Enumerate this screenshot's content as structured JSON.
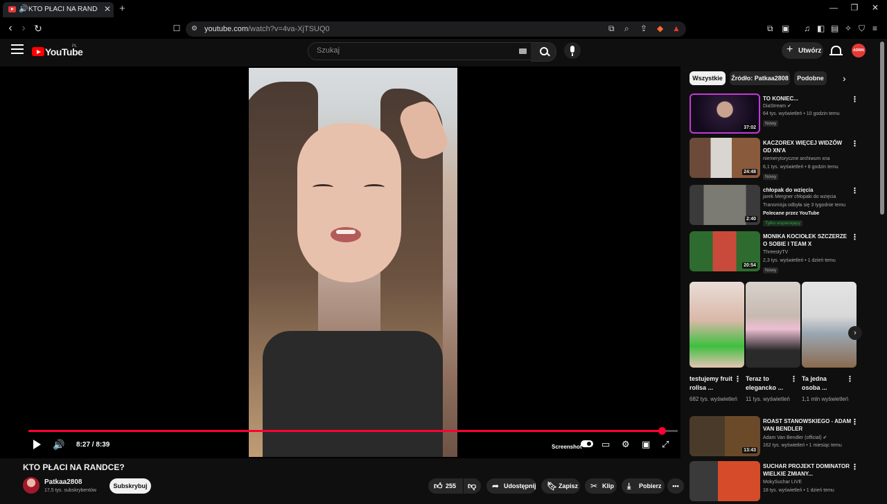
{
  "browser": {
    "tab_title": "KTO PŁACI NA RANDCE? - Yo",
    "url_host": "youtube.com",
    "url_rest": "/watch?v=4va-XjTSUQ0"
  },
  "header": {
    "logo": "YouTube",
    "region": "PL",
    "search_placeholder": "Szukaj",
    "create_label": "Utwórz",
    "avatar_text": "ADRIN"
  },
  "player": {
    "time": "8:27 / 8:39",
    "progress": 0.975,
    "screenshot_label": "Screenshot"
  },
  "video": {
    "title": "KTO PŁACI NA RANDCE?",
    "channel": "Patkaa2808",
    "subscribers": "17,5 tys. subskrybentów",
    "subscribe": "Subskrybuj",
    "likes": "255",
    "share": "Udostępnij",
    "save": "Zapisz",
    "clip": "Klip",
    "download": "Pobierz"
  },
  "sidebar": {
    "chips": [
      "Wszystkie",
      "Źródło: Patkaa2808",
      "Podobne"
    ],
    "recs": [
      {
        "title": "TO KONIEC...",
        "channel": "DiaStream",
        "meta": "64 tys. wyświetleń • 10 godzin temu",
        "badge": "Nowy",
        "duration": "37:02"
      },
      {
        "title": "KACZOREX WIĘCEJ WIDZÓW OD XN'A",
        "channel": "niemerytoryczne archiwum xna",
        "meta": "6,1 tys. wyświetleń • 8 godzin temu",
        "badge": "Nowy",
        "duration": "24:48"
      },
      {
        "title": "chłopak do wzięcia",
        "channel": "jarek Mergner chłopaki do wzięcia",
        "meta": "Transmisja odbyła się 3 tygodnie temu",
        "extra": "Polecane przez YouTube",
        "badge": "Tylko wspierający",
        "duration": "2:40"
      },
      {
        "title": "MONIKA KOCIOŁEK SZCZERZE O SOBIE I TEAM X",
        "channel": "ThreestyTV",
        "meta": "2,3 tys. wyświetleń • 1 dzień temu",
        "badge": "Nowy",
        "duration": "20:54"
      }
    ],
    "shorts": [
      {
        "title": "testujemy fruit rollsa ...",
        "views": "682 tys. wyświetleń"
      },
      {
        "title": "Teraz to elegancko ...",
        "views": "11 tys. wyświetleń"
      },
      {
        "title": "Ta jedna osoba ...",
        "views": "1,1 mln wyświetleń"
      }
    ],
    "recs2": [
      {
        "title": "ROAST STANOWSKIEGO - ADAM VAN BENDLER",
        "channel": "Adam Van Bendler (official)",
        "meta": "162 tys. wyświetleń • 1 miesiąc temu",
        "duration": "13:43"
      },
      {
        "title": "SUCHAR PROJEKT DOMINATOR WIELKIE ZMIANY...",
        "channel": "MokySuchar LIVE",
        "meta": "18 tys. wyświetleń • 1 dzień temu",
        "duration": ""
      }
    ]
  }
}
